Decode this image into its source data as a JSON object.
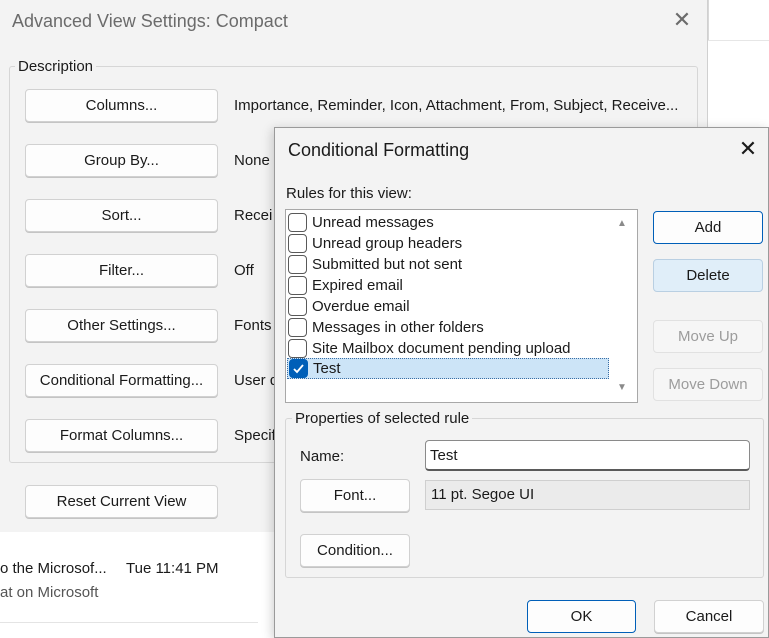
{
  "advanced_dialog": {
    "title": "Advanced View Settings: Compact",
    "description_label": "Description",
    "rows": [
      {
        "button": "Columns...",
        "value": "Importance, Reminder, Icon, Attachment, From, Subject, Receive..."
      },
      {
        "button": "Group By...",
        "value": "None"
      },
      {
        "button": "Sort...",
        "value": "Recei"
      },
      {
        "button": "Filter...",
        "value": "Off"
      },
      {
        "button": "Other Settings...",
        "value": "Fonts"
      },
      {
        "button": "Conditional Formatting...",
        "value": "User d"
      },
      {
        "button": "Format Columns...",
        "value": "Specif"
      }
    ],
    "reset_button": "Reset Current View"
  },
  "background_mail": {
    "sender": "o the Microsof...",
    "time": "Tue 11:41 PM",
    "preview": "at on Microsoft"
  },
  "conditional_formatting": {
    "title": "Conditional Formatting",
    "rules_label": "Rules for this view:",
    "rules": [
      {
        "label": "Unread messages",
        "checked": false
      },
      {
        "label": "Unread group headers",
        "checked": false
      },
      {
        "label": "Submitted but not sent",
        "checked": false
      },
      {
        "label": "Expired email",
        "checked": false
      },
      {
        "label": "Overdue email",
        "checked": false
      },
      {
        "label": "Messages in other folders",
        "checked": false
      },
      {
        "label": "Site Mailbox document pending upload",
        "checked": false
      },
      {
        "label": "Test",
        "checked": true,
        "selected": true
      }
    ],
    "buttons": {
      "add": "Add",
      "delete": "Delete",
      "move_up": "Move Up",
      "move_down": "Move Down",
      "ok": "OK",
      "cancel": "Cancel"
    },
    "properties": {
      "label": "Properties of selected rule",
      "name_label": "Name:",
      "name_value": "Test",
      "font_button": "Font...",
      "font_value": "11 pt. Segoe UI",
      "condition_button": "Condition..."
    }
  },
  "icons": {
    "close": "close-icon",
    "checkmark": "checkmark-icon",
    "scroll_up": "scroll-up-icon",
    "scroll_down": "scroll-down-icon"
  },
  "colors": {
    "accent": "#005fb8",
    "selection": "#cce4f7",
    "dialog_bg": "#f3f3f3"
  }
}
